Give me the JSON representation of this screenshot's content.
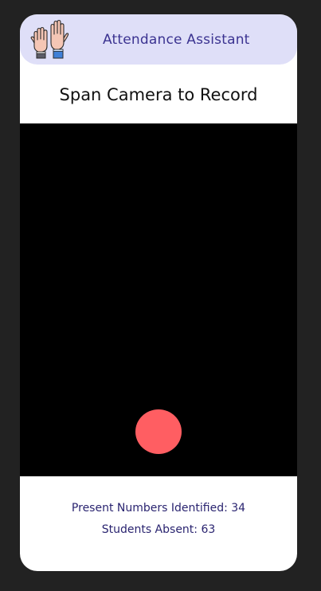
{
  "header": {
    "title": "Attendance Assistant",
    "logo_icon": "raised-hands-icon"
  },
  "instruction": "Span Camera to Record",
  "camera": {
    "record_button_color": "#ff5e62"
  },
  "stats": {
    "present_label": "Present Numbers Identified: 34",
    "absent_label": "Students Absent: 63"
  },
  "colors": {
    "header_bg": "#dfdff8",
    "accent_text": "#3b3391",
    "record": "#ff5e62"
  }
}
